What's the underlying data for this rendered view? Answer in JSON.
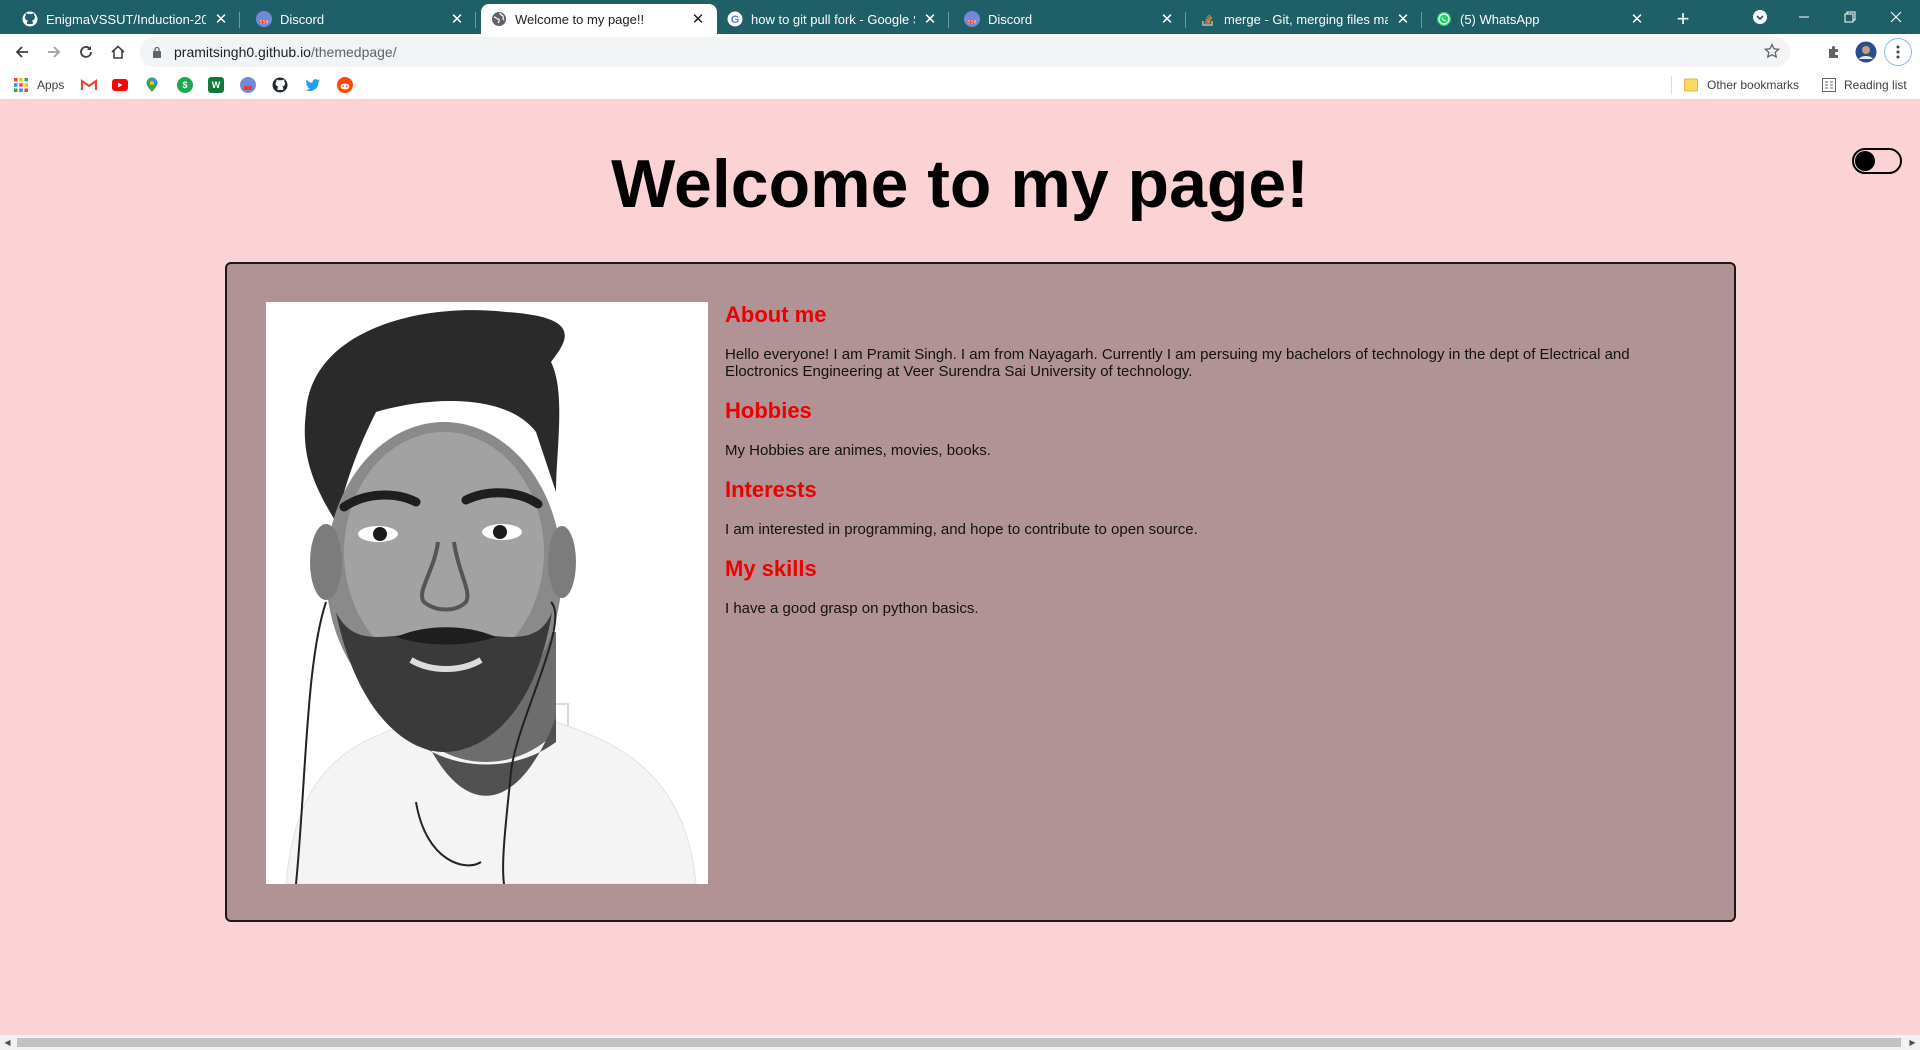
{
  "tabs": [
    {
      "title": "EnigmaVSSUT/Induction-2021: I",
      "icon": "github-icon",
      "active": false
    },
    {
      "title": "Discord",
      "icon": "discord-icon",
      "active": false
    },
    {
      "title": "Welcome to my page!!",
      "icon": "globe-icon",
      "active": true
    },
    {
      "title": "how to git pull fork - Google Sea",
      "icon": "google-icon",
      "active": false
    },
    {
      "title": "Discord",
      "icon": "discord-icon",
      "active": false
    },
    {
      "title": "merge - Git, merging files manu",
      "icon": "stackoverflow-icon",
      "active": false
    },
    {
      "title": "(5) WhatsApp",
      "icon": "whatsapp-icon",
      "active": false
    }
  ],
  "address": {
    "domain": "pramitsingh0.github.io",
    "path": "/themedpage/"
  },
  "bookmarks": {
    "apps_label": "Apps",
    "items": [
      "gmail-icon",
      "youtube-icon",
      "maps-icon",
      "green-s-icon",
      "green-app-icon",
      "discord-icon",
      "github-icon",
      "twitter-icon",
      "reddit-icon"
    ],
    "other_label": "Other bookmarks",
    "reading_label": "Reading list"
  },
  "page": {
    "title": "Welcome to my page!",
    "theme_toggle": "off",
    "sections": [
      {
        "heading": "About me",
        "body": "Hello everyone! I am Pramit Singh. I am from Nayagarh. Currently I am persuing my bachelors of technology in the dept of Electrical and Eloctronics Engineering at Veer Surendra Sai University of technology."
      },
      {
        "heading": "Hobbies",
        "body": "My Hobbies are animes, movies, books."
      },
      {
        "heading": "Interests",
        "body": "I am interested in programming, and hope to contribute to open source."
      },
      {
        "heading": "My skills",
        "body": "I have a good grasp on python basics."
      }
    ]
  },
  "colors": {
    "page_bg": "#fcd3d4",
    "card_bg": "#b29395",
    "heading": "#ee0000",
    "tabstrip": "#1f5f67"
  }
}
